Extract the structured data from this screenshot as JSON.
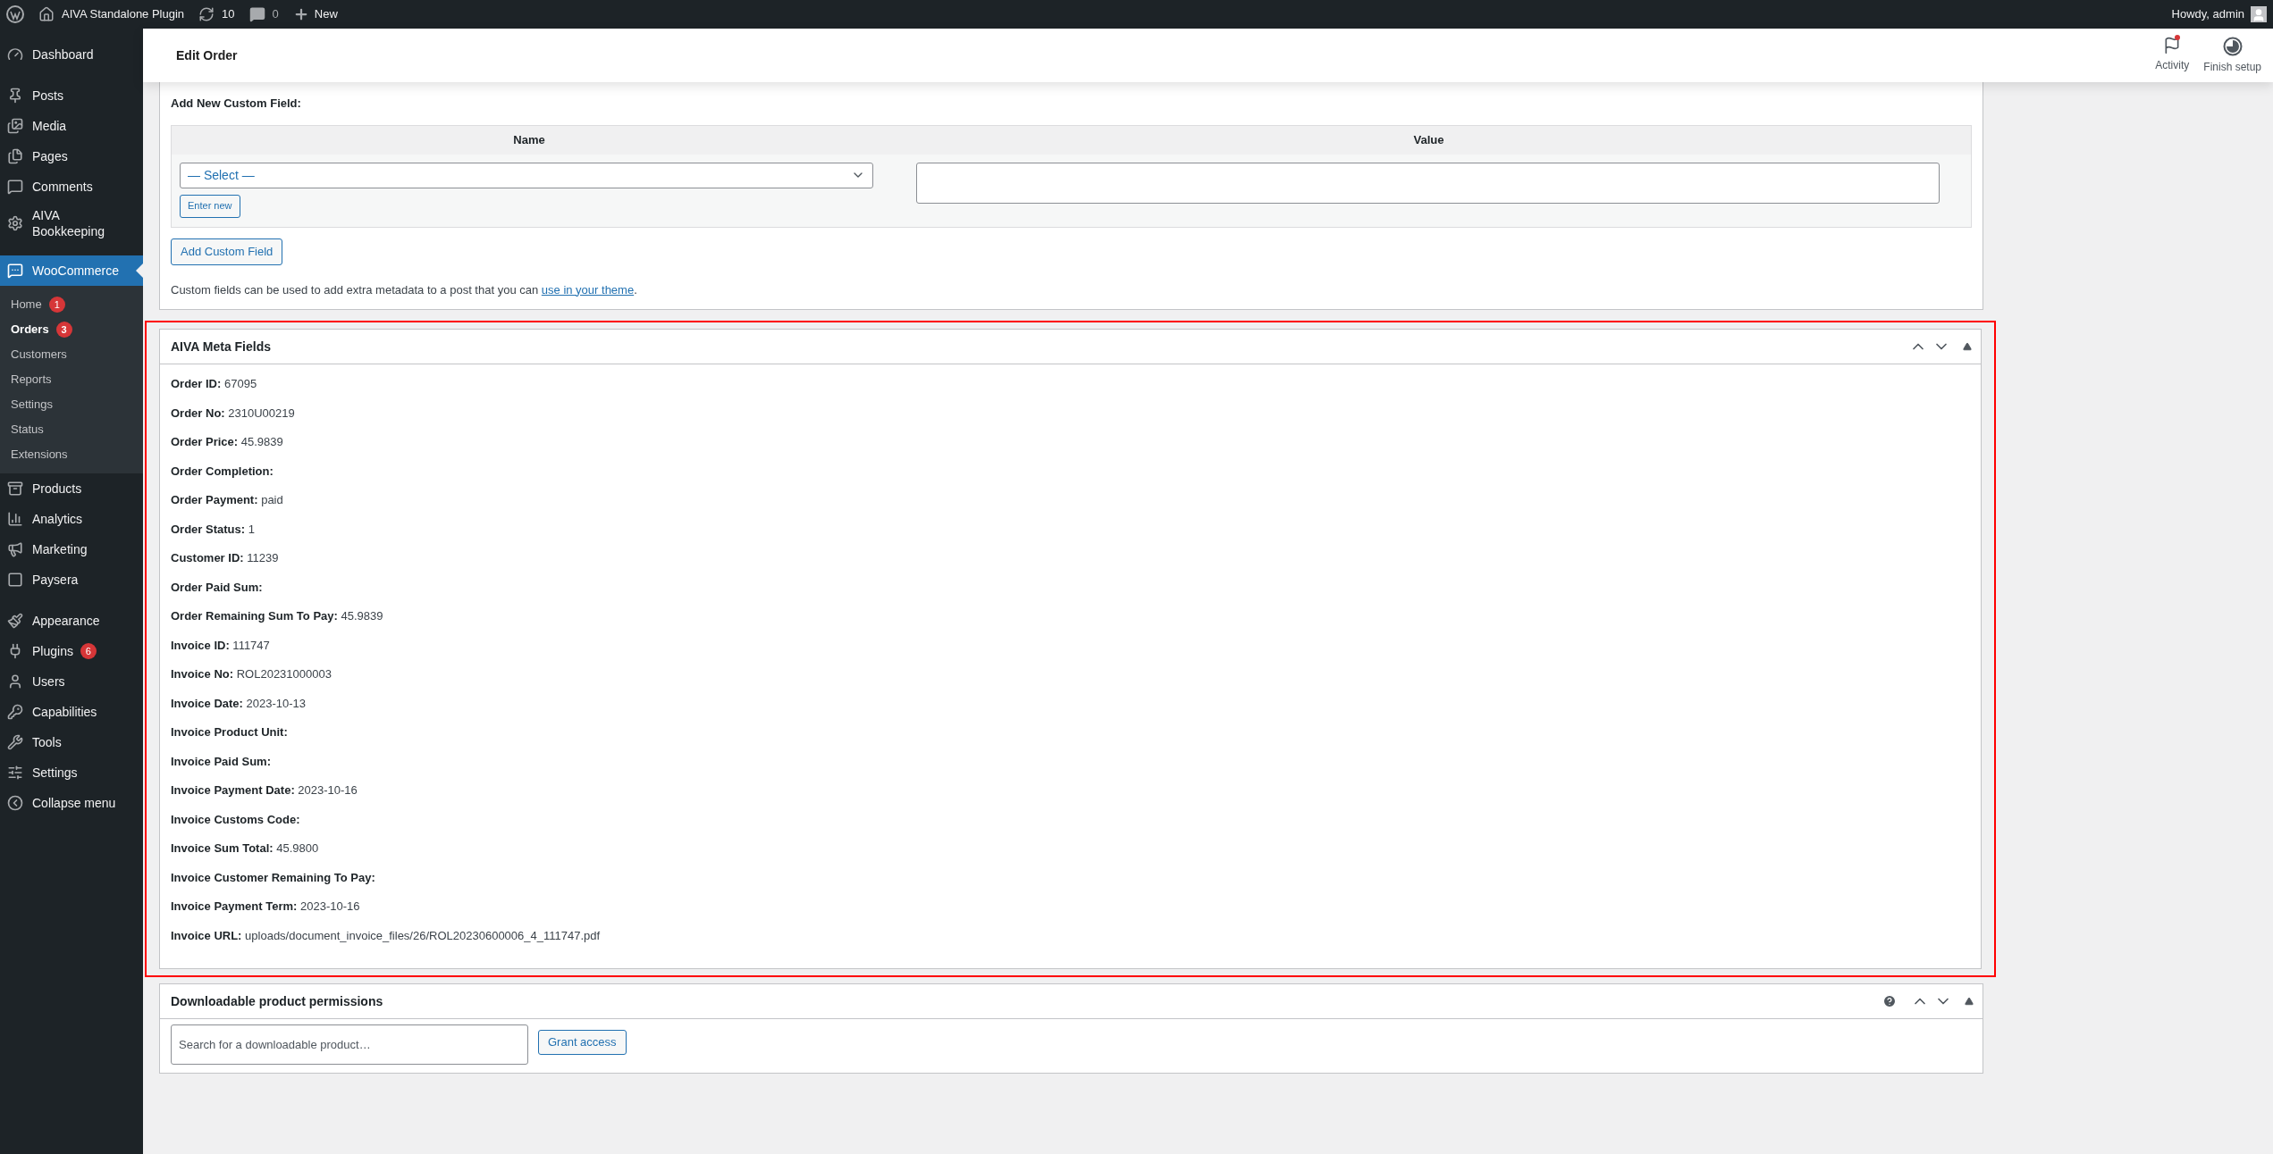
{
  "admin_bar": {
    "site": "AIVA Standalone Plugin",
    "updates": "10",
    "comments": "0",
    "new": "New",
    "greeting": "Howdy, admin"
  },
  "sidebar": {
    "groups": [
      {
        "items": [
          {
            "label": "Dashboard",
            "selected": false
          }
        ]
      },
      {
        "items": [
          {
            "label": "Posts",
            "selected": false
          },
          {
            "label": "Media",
            "selected": false
          },
          {
            "label": "Pages",
            "selected": false
          },
          {
            "label": "Comments",
            "selected": false
          },
          {
            "label": "AIVA Bookkeeping",
            "selected": false
          }
        ]
      },
      {
        "items": [
          {
            "label": "WooCommerce",
            "selected": true,
            "children": [
              {
                "label": "Home",
                "badge": "1",
                "selected": false
              },
              {
                "label": "Orders",
                "badge": "3",
                "selected": true
              },
              {
                "label": "Customers",
                "selected": false
              },
              {
                "label": "Reports",
                "selected": false
              },
              {
                "label": "Settings",
                "selected": false
              },
              {
                "label": "Status",
                "selected": false
              },
              {
                "label": "Extensions",
                "selected": false
              }
            ]
          },
          {
            "label": "Products",
            "selected": false
          },
          {
            "label": "Analytics",
            "selected": false
          },
          {
            "label": "Marketing",
            "selected": false
          },
          {
            "label": "Paysera",
            "selected": false
          }
        ]
      },
      {
        "items": [
          {
            "label": "Appearance",
            "selected": false
          },
          {
            "label": "Plugins",
            "badge": "6",
            "selected": false
          },
          {
            "label": "Users",
            "selected": false
          },
          {
            "label": "Capabilities",
            "selected": false
          },
          {
            "label": "Tools",
            "selected": false
          },
          {
            "label": "Settings",
            "selected": false
          },
          {
            "label": "Collapse menu",
            "selected": false
          }
        ]
      }
    ]
  },
  "header": {
    "title": "Edit Order",
    "actions": [
      {
        "label": "Activity",
        "unread": true
      },
      {
        "label": "Finish setup",
        "unread": false
      }
    ]
  },
  "custom_fields": {
    "heading": "Add New Custom Field:",
    "columns": [
      "Name",
      "Value"
    ],
    "select_value": "— Select —",
    "enter_new": "Enter new",
    "add_button": "Add Custom Field",
    "help_before": "Custom fields can be used to add extra metadata to a post that you can ",
    "help_link": "use in your theme",
    "help_after": "."
  },
  "meta_box": {
    "title": "AIVA Meta Fields",
    "highlighted": true,
    "rows": [
      {
        "label": "Order ID:",
        "value": "67095"
      },
      {
        "label": "Order No:",
        "value": "2310U00219"
      },
      {
        "label": "Order Price:",
        "value": "45.9839"
      },
      {
        "label": "Order Completion:"
      },
      {
        "label": "Order Payment:",
        "value": "paid"
      },
      {
        "label": "Order Status:",
        "value": "1"
      },
      {
        "label": "Customer ID:",
        "value": "11239"
      },
      {
        "label": "Order Paid Sum:"
      },
      {
        "label": "Order Remaining Sum To Pay:",
        "value": "45.9839"
      },
      {
        "label": "Invoice ID:",
        "value": "111747"
      },
      {
        "label": "Invoice No:",
        "value": "ROL20231000003"
      },
      {
        "label": "Invoice Date:",
        "value": "2023-10-13"
      },
      {
        "label": "Invoice Product Unit:"
      },
      {
        "label": "Invoice Paid Sum:"
      },
      {
        "label": "Invoice Payment Date:",
        "value": "2023-10-16"
      },
      {
        "label": "Invoice Customs Code:"
      },
      {
        "label": "Invoice Sum Total:",
        "value": "45.9800"
      },
      {
        "label": "Invoice Customer Remaining To Pay:"
      },
      {
        "label": "Invoice Payment Term:",
        "value": "2023-10-16"
      },
      {
        "label": "Invoice URL:",
        "value": "uploads/document_invoice_files/26/ROL20230600006_4_111747.pdf"
      }
    ]
  },
  "downloads": {
    "title": "Downloadable product permissions",
    "placeholder": "Search for a downloadable product…",
    "button": "Grant access"
  }
}
